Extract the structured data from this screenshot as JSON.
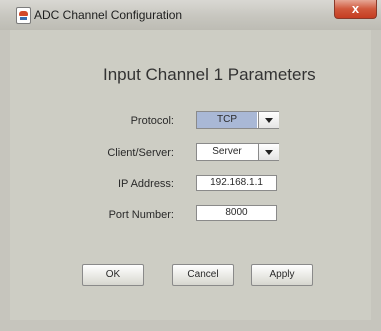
{
  "window": {
    "title": "ADC Channel Configuration",
    "close_label": "x"
  },
  "heading": "Input Channel 1 Parameters",
  "form": {
    "protocol": {
      "label": "Protocol:",
      "value": "TCP"
    },
    "client_server": {
      "label": "Client/Server:",
      "value": "Server"
    },
    "ip_address": {
      "label": "IP Address:",
      "value": "192.168.1.1"
    },
    "port_number": {
      "label": "Port Number:",
      "value": "8000"
    }
  },
  "buttons": {
    "ok": "OK",
    "cancel": "Cancel",
    "apply": "Apply"
  },
  "colors": {
    "selected_combo": "#a9b8d6",
    "dialog_background": "#cdcdc4"
  }
}
